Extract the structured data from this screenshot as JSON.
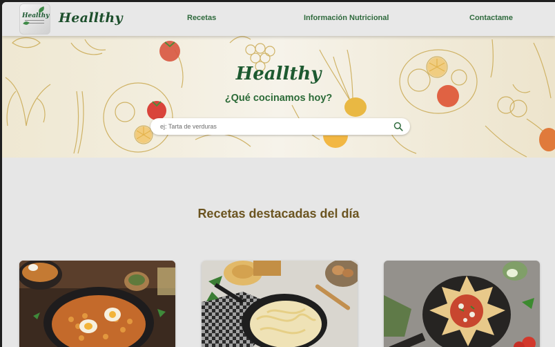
{
  "header": {
    "logo_text": "Healthy",
    "brand": "Heallthy",
    "nav": [
      "Recetas",
      "Información Nutricional",
      "Contactame"
    ]
  },
  "hero": {
    "title": "Heallthy",
    "subtitle": "¿Qué cocinamos hoy?",
    "search": {
      "placeholder": "ej: Tarta de verduras",
      "value": ""
    }
  },
  "featured": {
    "title": "Recetas destacadas del día",
    "cards": [
      {
        "image": "chickpea-stew-photo"
      },
      {
        "image": "fettuccine-alfredo-photo"
      },
      {
        "image": "star-pastry-tart-photo"
      }
    ]
  },
  "colors": {
    "brand_green": "#1d4f2c",
    "nav_green": "#2f6a3d",
    "section_brown": "#6b5420",
    "page_bg": "#e6e6e6"
  }
}
